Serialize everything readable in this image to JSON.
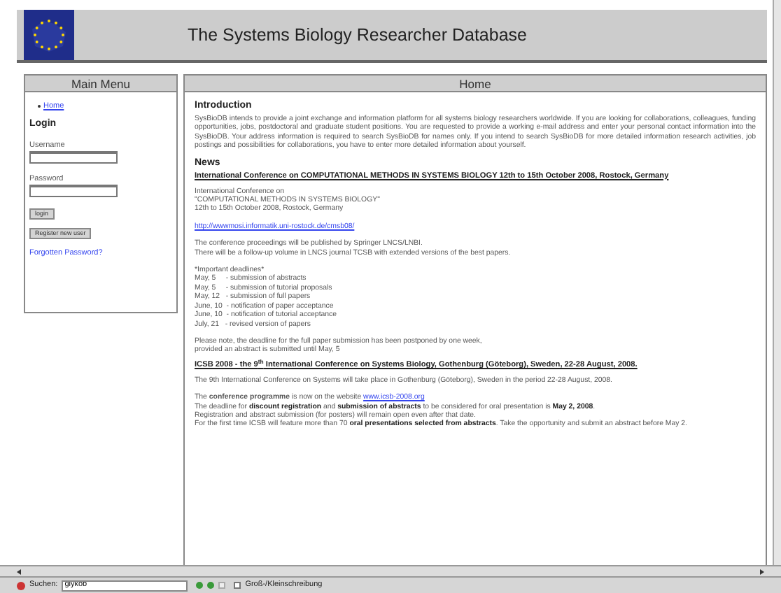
{
  "header": {
    "title": "The Systems Biology Researcher Database"
  },
  "menu": {
    "title": "Main Menu",
    "links": [
      {
        "label": "Home"
      }
    ],
    "login": {
      "heading": "Login",
      "username_label": "Username",
      "password_label": "Password",
      "login_button": "login",
      "register_button": "Register new user",
      "forgot_link": "Forgotten Password?"
    }
  },
  "main": {
    "title": "Home",
    "intro_heading": "Introduction",
    "intro_text": "SysBioDB intends to provide a joint exchange and information platform for all systems biology researchers worldwide. If you are looking for collaborations, colleagues, funding opportunities, jobs, postdoctoral and graduate student positions. You are requested to provide a working e-mail address and enter your personal contact information into the SysBioDB. Your address information is required to search SysBioDB for names only. If you intend to search SysBioDB for more detailed information research activities, job postings and possibilities for collaborations, you have to enter more detailed information about yourself.",
    "news_heading": "News",
    "news": [
      {
        "headline": "International Conference on COMPUTATIONAL METHODS IN SYSTEMS BIOLOGY 12th to 15th October 2008, Rostock, Germany",
        "blocks": [
          {
            "kind": "lines",
            "lines": [
              "International Conference on",
              "\"COMPUTATIONAL METHODS IN SYSTEMS BIOLOGY\"",
              "12th to 15th October 2008, Rostock, Germany"
            ]
          },
          {
            "kind": "link",
            "lines": [
              "http://wwwmosi.informatik.uni-rostock.de/cmsb08/"
            ]
          },
          {
            "kind": "lines",
            "lines": [
              "The conference proceedings will be published by Springer LNCS/LNBI.",
              "There will be a follow-up volume in LNCS journal TCSB with extended versions of the best papers."
            ]
          },
          {
            "kind": "plain",
            "lines": [
              "*Important deadlines*",
              "May, 5     - submission of abstracts",
              "May, 5     - submission of tutorial proposals",
              "May, 12   - submission of full papers",
              "June, 10  - notification of paper acceptance",
              "June, 10  - notification of tutorial acceptance",
              "July, 21   - revised version of papers"
            ]
          },
          {
            "kind": "lines",
            "lines": [
              "Please note, the deadline for the full paper submission has been postponed by one week,",
              "provided an abstract is submitted until May, 5"
            ]
          }
        ]
      },
      {
        "headline": "ICSB 2008 - the 9$^{th}$ International Conference on Systems Biology, Gothenburg (Göteborg), Sweden, 22-28 August, 2008.",
        "blocks": [
          {
            "kind": "lines",
            "lines": [
              "The 9th International Conference on Systems will take place in Gothenburg (Göteborg), Sweden in the period 22-28 August, 2008."
            ]
          },
          {
            "kind": "mixed",
            "parts": [
              {
                "kind": "text",
                "text": "The **conference programme** is now on the website "
              },
              {
                "kind": "link",
                "text": "www.icsb-2008.org"
              }
            ]
          },
          {
            "kind": "lines",
            "lines": [
              "The deadline for **discount registration** and **submission of abstracts** to be considered for oral presentation is **May 2, 2008**.",
              "Registration and abstract submission (for posters) will remain open even after that date.",
              "For the first time ICSB will feature more than 70 **oral presentations selected from abstracts**. Take the opportunity and submit an abstract before May 2."
            ]
          }
        ]
      }
    ]
  },
  "findbar": {
    "label": "Suchen:",
    "value": "glykob",
    "match_case": {
      "label": "Groß-/Kleinschreibung",
      "checked": false
    }
  }
}
